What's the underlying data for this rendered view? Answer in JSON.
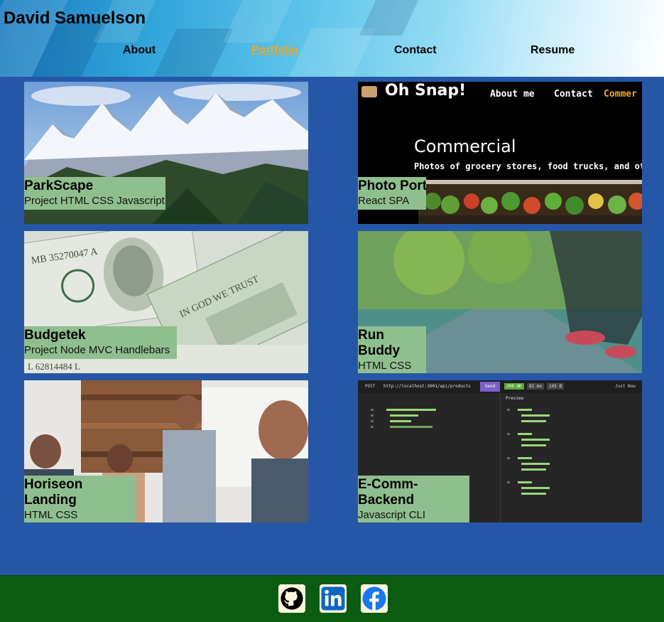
{
  "header": {
    "title": "David Samuelson",
    "nav": [
      {
        "label": "About",
        "active": false
      },
      {
        "label": "Portfolio",
        "active": true
      },
      {
        "label": "Contact",
        "active": false
      },
      {
        "label": "Resume",
        "active": false
      }
    ]
  },
  "projects": [
    {
      "name": "ParkScape",
      "tech": "Project HTML CSS Javascript",
      "image": "mountain-landscape"
    },
    {
      "name": "Photo Port",
      "tech": "React SPA",
      "image": "oh-snap-commercial-screenshot",
      "screenshot": {
        "brand": "Oh Snap!",
        "nav": [
          "About me",
          "Contact",
          "Commer"
        ],
        "heading": "Commercial",
        "subheading": "Photos of grocery stores, food trucks, and ot"
      }
    },
    {
      "name": "Budgetek",
      "tech": "Project Node MVC Handlebars",
      "image": "dollar-bills"
    },
    {
      "name": "Run Buddy",
      "tech": "HTML CSS",
      "image": "runner-tying-shoe"
    },
    {
      "name": "Horiseon Landing",
      "tech": "HTML CSS",
      "image": "team-meeting"
    },
    {
      "name": "E-Comm-Backend",
      "tech": "Javascript CLI",
      "image": "api-client-screenshot",
      "screenshot": {
        "method": "POST",
        "url": "http://localhost:3001/api/products",
        "send": "Send",
        "status": "200 OK",
        "time": "82 ms",
        "size": "145 B",
        "preview": "Preview",
        "just_now": "Just Now"
      }
    }
  ],
  "footer": {
    "links": [
      {
        "icon": "github-icon"
      },
      {
        "icon": "linkedin-icon"
      },
      {
        "icon": "facebook-icon"
      }
    ]
  },
  "colors": {
    "accent": "#f5a623",
    "background": "#2557a6",
    "caption": "#8fbf8f",
    "footer": "#0b5c10"
  }
}
